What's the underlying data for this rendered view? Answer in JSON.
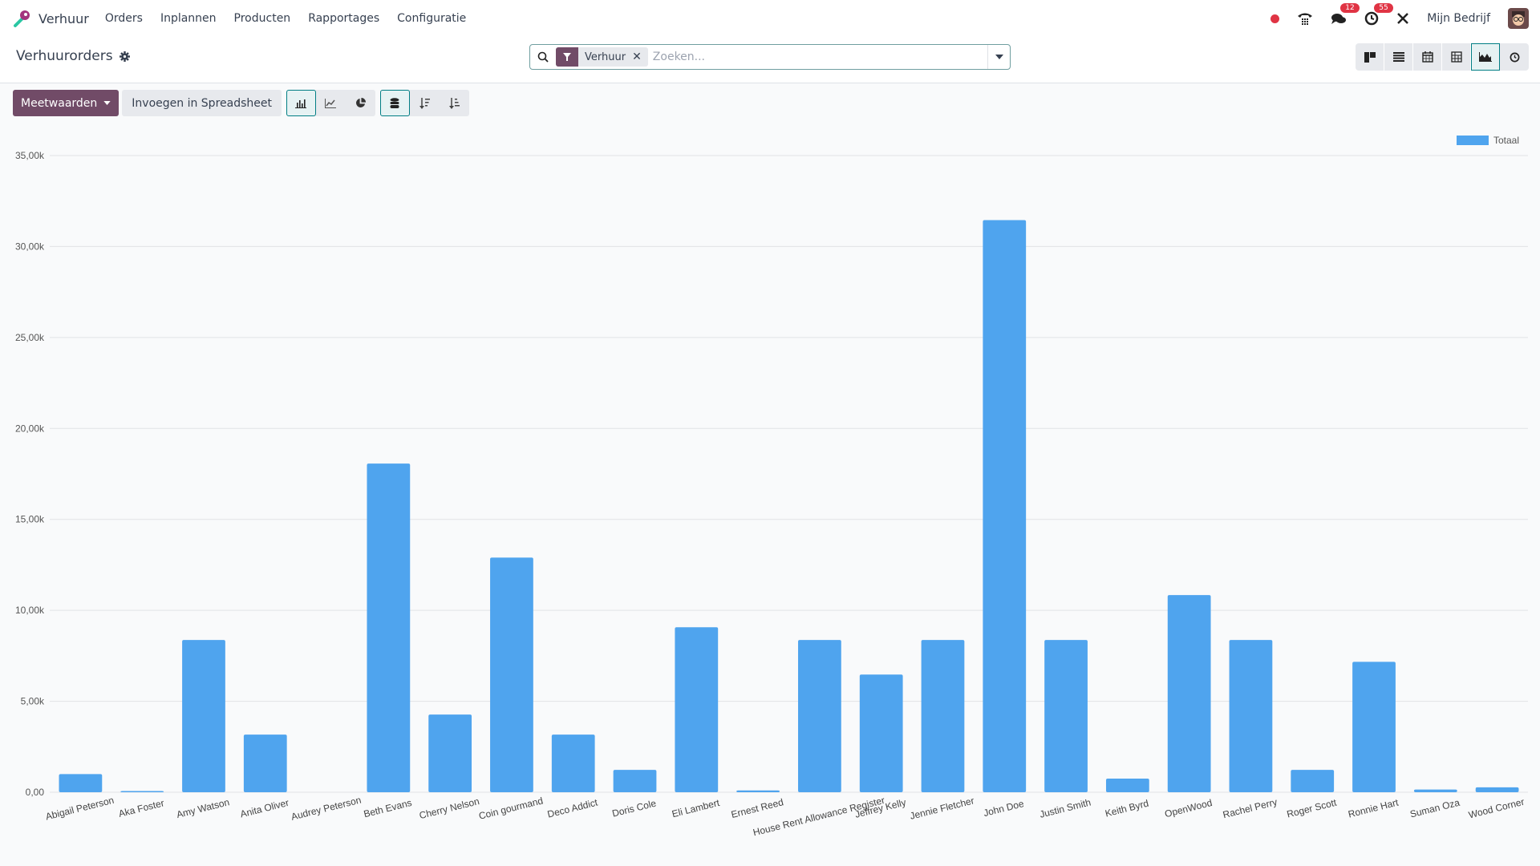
{
  "navbar": {
    "app_name": "Verhuur",
    "menu": [
      "Orders",
      "Inplannen",
      "Producten",
      "Rapportages",
      "Configuratie"
    ],
    "messages_count": "12",
    "activities_count": "55",
    "company": "Mijn Bedrijf"
  },
  "control_panel": {
    "title": "Verhuurorders",
    "search": {
      "facet_label": "Verhuur",
      "placeholder": "Zoeken..."
    },
    "views": [
      "kanban",
      "list",
      "calendar",
      "pivot",
      "graph",
      "activity"
    ],
    "active_view": "graph"
  },
  "toolbar": {
    "measures_label": "Meetwaarden",
    "spreadsheet_label": "Invoegen in Spreadsheet"
  },
  "colors": {
    "brand": "#714b67",
    "accent": "#017e84",
    "bar": "#4fa4ee",
    "badge": "#e03444"
  },
  "chart_data": {
    "type": "bar",
    "title": "",
    "xlabel": "",
    "ylabel": "",
    "ylim": [
      0,
      35000
    ],
    "yticks": [
      0,
      5000,
      10000,
      15000,
      20000,
      25000,
      30000,
      35000
    ],
    "ytick_labels": [
      "0,00",
      "5,00k",
      "10,00k",
      "15,00k",
      "20,00k",
      "25,00k",
      "30,00k",
      "35,00k"
    ],
    "grid": true,
    "legend_position": "top-right",
    "categories": [
      "Abigail Peterson",
      "Aka Foster",
      "Amy Watson",
      "Anita Oliver",
      "Audrey Peterson",
      "Beth Evans",
      "Cherry Nelson",
      "Coin gourmand",
      "Deco Addict",
      "Doris Cole",
      "Eli Lambert",
      "Ernest Reed",
      "House Rent Allowance Register",
      "Jeffrey Kelly",
      "Jennie Fletcher",
      "John Doe",
      "Justin Smith",
      "Keith Byrd",
      "OpenWood",
      "Rachel Perry",
      "Roger Scott",
      "Ronnie Hart",
      "Suman Oza",
      "Wood Corner"
    ],
    "series": [
      {
        "name": "Totaal",
        "values": [
          1000,
          30,
          8370,
          3170,
          0,
          18070,
          4270,
          12900,
          3170,
          1230,
          9070,
          100,
          8370,
          6470,
          8370,
          31450,
          8370,
          750,
          10840,
          8370,
          1230,
          7170,
          150,
          270
        ]
      }
    ]
  }
}
